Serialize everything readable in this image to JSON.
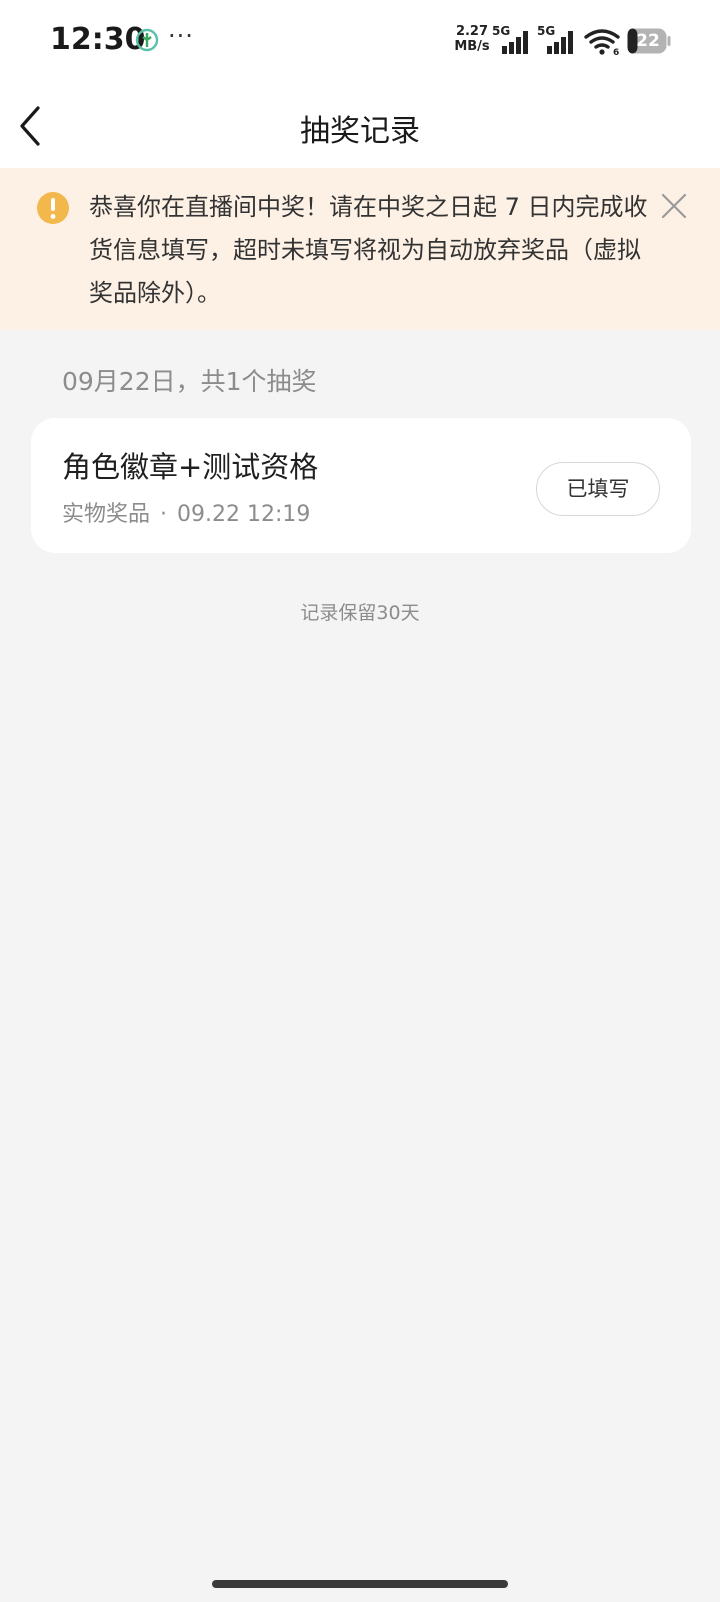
{
  "status_bar": {
    "time": "12:30",
    "more": "···",
    "net_speed_value": "2.27",
    "net_speed_unit": "MB/s",
    "sim1_label": "5G",
    "sim2_label": "5G",
    "wifi_sub": "6",
    "battery_level": "22",
    "icons": [
      "app-notification-icon",
      "signal-icon",
      "wifi-icon",
      "battery-icon"
    ]
  },
  "nav": {
    "title": "抽奖记录",
    "back_icon": "chevron-left-icon"
  },
  "notice": {
    "text": "恭喜你在直播间中奖！请在中奖之日起 7 日内完成收货信息填写，超时未填写将视为自动放弃奖品（虚拟奖品除外）。",
    "icon": "warning-icon",
    "close_icon": "close-icon",
    "accent_color": "#f2b84b",
    "background_color": "#fdf1e6"
  },
  "records": {
    "date_header": "09月22日，共1个抽奖",
    "items": [
      {
        "title": "角色徽章+测试资格",
        "type": "实物奖品",
        "separator": "·",
        "time": "09.22 12:19",
        "button_label": "已填写"
      }
    ]
  },
  "footer": {
    "retention_note": "记录保留30天"
  }
}
